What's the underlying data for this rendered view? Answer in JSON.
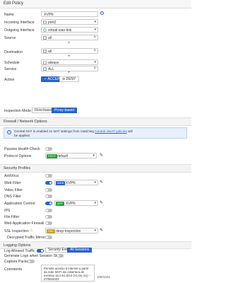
{
  "window": {
    "title": "Edit Policy"
  },
  "policy": {
    "name_label": "Name",
    "name_value": "XVPN",
    "incoming_label": "Incoming Interface",
    "incoming_value": "port2",
    "outgoing_label": "Outgoing Interface",
    "outgoing_value": "virtual-wan-link",
    "source_label": "Source",
    "source_value": "all",
    "destination_label": "Destination",
    "destination_value": "all",
    "schedule_label": "Schedule",
    "schedule_value": "always",
    "service_label": "Service",
    "service_value": "ALL",
    "action_label": "Action",
    "accept_label": "ACCEPT",
    "deny_label": "DENY",
    "inspection_label": "Inspection Mode",
    "flow_label": "Flow-based",
    "proxy_label": "Proxy-based"
  },
  "firewall_nat": {
    "section_title": "Firewall / Network Options",
    "info_text_1": "Central NAT is enabled so NAT settings from matching ",
    "info_link": "Central SNAT policies",
    "info_text_2": " will be applied.",
    "passive_label": "Passive Health Check",
    "protocol_label": "Protocol Options",
    "protocol_badge": "PROT",
    "protocol_value": "default"
  },
  "security_profiles": {
    "section_title": "Security Profiles",
    "antivirus": "AntiVirus",
    "webfilter": "Web Filter",
    "webfilter_badge": "WEB",
    "webfilter_value": "XVPN",
    "videofilter": "Video Filter",
    "dnsfilter": "DNS Filter",
    "appcontrol": "Application Control",
    "appcontrol_badge": "APP",
    "appcontrol_value": "XVPN",
    "ips": "IPS",
    "filefilter": "File Filter",
    "waf": "Web Application Firewall",
    "ssl": "SSL Inspection",
    "ssl_badge": "SSL",
    "ssl_value": "deep-inspection",
    "mirror": "Decrypted Traffic Mirror"
  },
  "logging": {
    "section_title": "Logging Options",
    "log_allowed": "Log Allowed Traffic",
    "security_events": "Security Events",
    "all_sessions": "All Sessions",
    "gen_logs": "Generate Logs when Session Starts",
    "capture": "Capture Packets"
  },
  "comments": {
    "label": "Comments",
    "value": "Permite acesso à internet a partir da rede Wi-Fi da cobertura de eventos 10.0.61.0/24 (VLAN_61) - 07/06/2023",
    "count": "108/1023"
  },
  "colors": {
    "accent": "#2a62c9",
    "web_badge": "#2a62c9",
    "app_badge": "#2e9b3f",
    "prot_badge": "#2e9b3f",
    "ssl_badge": "#c9a227"
  }
}
